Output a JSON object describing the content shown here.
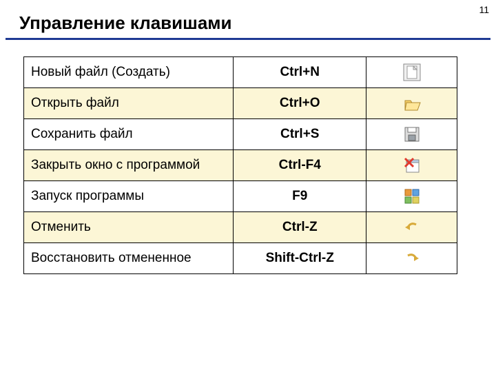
{
  "page_number": "11",
  "title": "Управление клавишами",
  "rows": [
    {
      "action": "Новый файл (Создать)",
      "key": "Ctrl+N",
      "icon": "new-file-icon"
    },
    {
      "action": "Открыть файл",
      "key": "Ctrl+O",
      "icon": "open-file-icon"
    },
    {
      "action": "Сохранить файл",
      "key": "Ctrl+S",
      "icon": "save-icon"
    },
    {
      "action": "Закрыть окно с программой",
      "key": "Ctrl-F4",
      "icon": "close-window-icon"
    },
    {
      "action": "Запуск программы",
      "key": "F9",
      "icon": "run-icon"
    },
    {
      "action": "Отменить",
      "key": "Ctrl-Z",
      "icon": "undo-icon"
    },
    {
      "action": "Восстановить отмененное",
      "key": "Shift-Ctrl-Z",
      "icon": "redo-icon"
    }
  ]
}
